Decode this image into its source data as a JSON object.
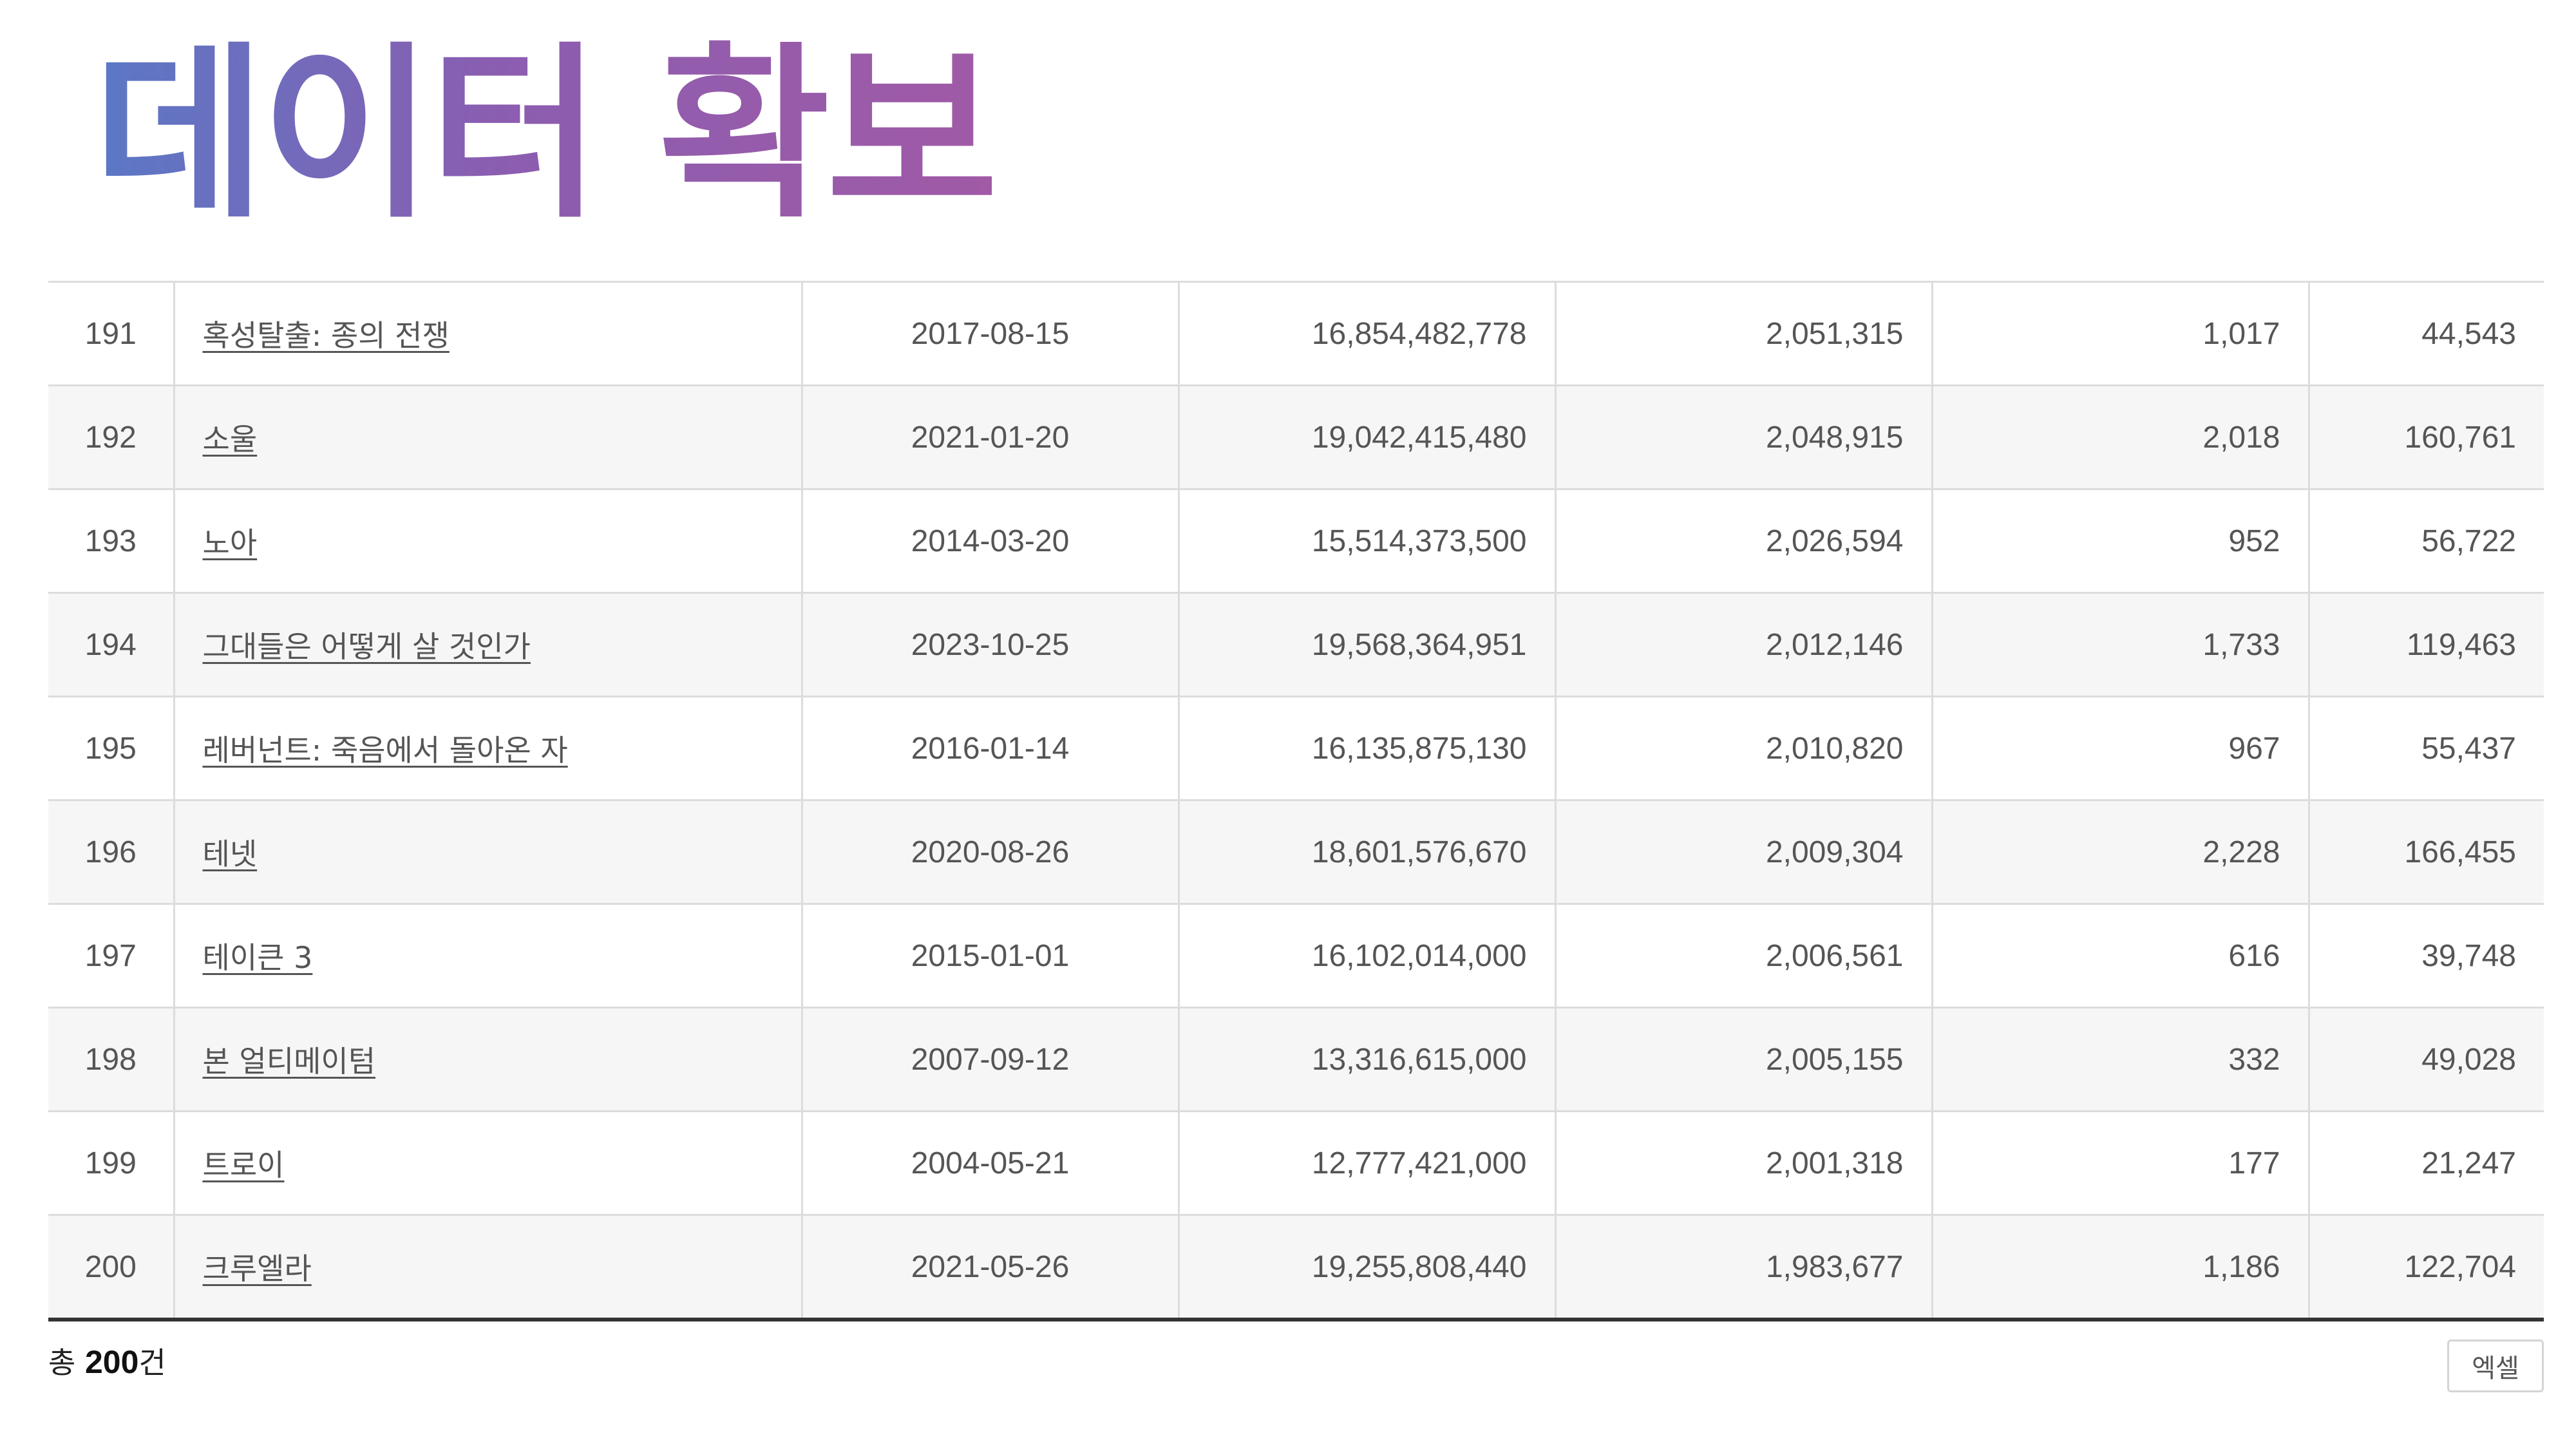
{
  "page": {
    "title": "데이터 확보"
  },
  "table": {
    "rows": [
      {
        "rank": "191",
        "title": "혹성탈출: 종의 전쟁",
        "date": "2017-08-15",
        "sales": "16,854,482,778",
        "audience": "2,051,315",
        "screens": "1,017",
        "showings": "44,543"
      },
      {
        "rank": "192",
        "title": "소울",
        "date": "2021-01-20",
        "sales": "19,042,415,480",
        "audience": "2,048,915",
        "screens": "2,018",
        "showings": "160,761"
      },
      {
        "rank": "193",
        "title": "노아",
        "date": "2014-03-20",
        "sales": "15,514,373,500",
        "audience": "2,026,594",
        "screens": "952",
        "showings": "56,722"
      },
      {
        "rank": "194",
        "title": "그대들은 어떻게 살 것인가",
        "date": "2023-10-25",
        "sales": "19,568,364,951",
        "audience": "2,012,146",
        "screens": "1,733",
        "showings": "119,463"
      },
      {
        "rank": "195",
        "title": "레버넌트: 죽음에서 돌아온 자",
        "date": "2016-01-14",
        "sales": "16,135,875,130",
        "audience": "2,010,820",
        "screens": "967",
        "showings": "55,437"
      },
      {
        "rank": "196",
        "title": "테넷",
        "date": "2020-08-26",
        "sales": "18,601,576,670",
        "audience": "2,009,304",
        "screens": "2,228",
        "showings": "166,455"
      },
      {
        "rank": "197",
        "title": "테이큰 3",
        "date": "2015-01-01",
        "sales": "16,102,014,000",
        "audience": "2,006,561",
        "screens": "616",
        "showings": "39,748"
      },
      {
        "rank": "198",
        "title": "본 얼티메이텀",
        "date": "2007-09-12",
        "sales": "13,316,615,000",
        "audience": "2,005,155",
        "screens": "332",
        "showings": "49,028"
      },
      {
        "rank": "199",
        "title": "트로이",
        "date": "2004-05-21",
        "sales": "12,777,421,000",
        "audience": "2,001,318",
        "screens": "177",
        "showings": "21,247"
      },
      {
        "rank": "200",
        "title": "크루엘라",
        "date": "2021-05-26",
        "sales": "19,255,808,440",
        "audience": "1,983,677",
        "screens": "1,186",
        "showings": "122,704"
      }
    ]
  },
  "footer": {
    "total_prefix": "총",
    "total_count": "200",
    "total_suffix": "건",
    "excel_label": "엑셀"
  },
  "colors": {
    "title_gradient_start": "#5a78c6",
    "title_gradient_end": "#a05aa6",
    "row_alt_bg": "#f6f6f6",
    "bottom_rule": "#333333"
  }
}
